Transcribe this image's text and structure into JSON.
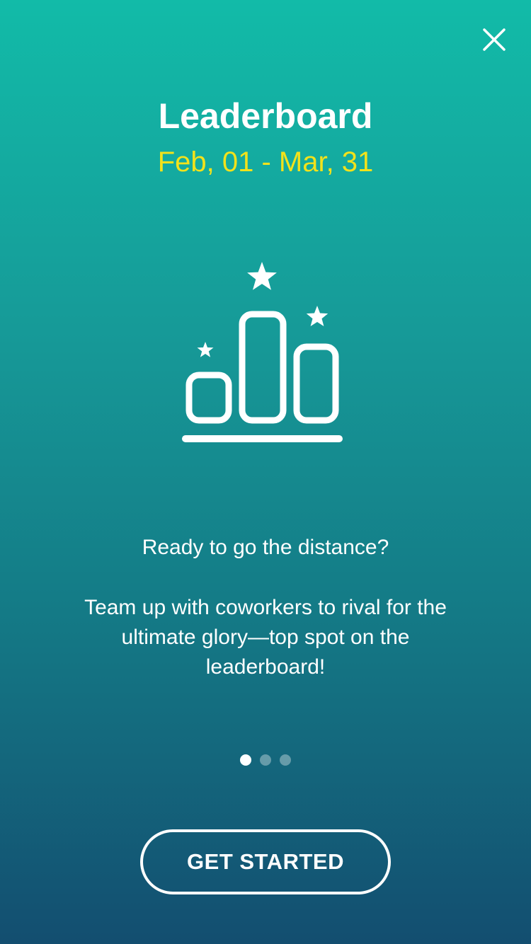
{
  "header": {
    "close_icon": "close-icon",
    "title": "Leaderboard",
    "date_range": "Feb, 01 - Mar, 31"
  },
  "illustration": {
    "icon": "leaderboard-podium-icon"
  },
  "content": {
    "headline": "Ready to go the distance?",
    "description": "Team up with coworkers to rival for the ultimate glory—top spot on the leaderboard!"
  },
  "pager": {
    "current_page": 1,
    "total_pages": 3
  },
  "footer": {
    "cta_label": "GET STARTED"
  },
  "colors": {
    "text": "#ffffff",
    "date_accent": "#f2e21b",
    "gradient_top": "#12bba8",
    "gradient_bottom": "#134e70"
  }
}
